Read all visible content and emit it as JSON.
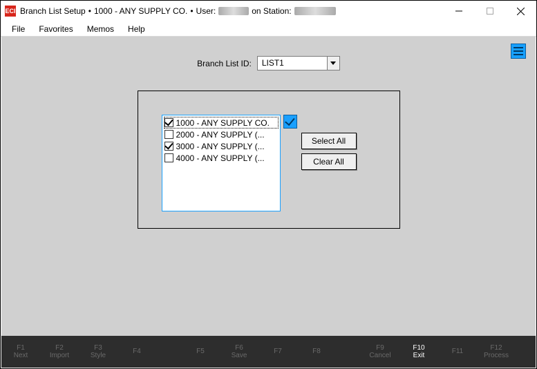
{
  "title": {
    "app_icon_text": "ECI",
    "window_name": "Branch List Setup",
    "sep": "•",
    "company": "1000 - ANY SUPPLY CO.",
    "user_prefix": "User:",
    "station_prefix": "on Station:"
  },
  "menu": {
    "file": "File",
    "favorites": "Favorites",
    "memos": "Memos",
    "help": "Help"
  },
  "form": {
    "id_label": "Branch List ID:",
    "id_value": "LIST1"
  },
  "branches": [
    {
      "label": "1000 - ANY SUPPLY CO.",
      "checked": true,
      "focused": true
    },
    {
      "label": "2000 - ANY SUPPLY (...",
      "checked": false,
      "focused": false
    },
    {
      "label": "3000 - ANY SUPPLY (...",
      "checked": true,
      "focused": false
    },
    {
      "label": "4000 - ANY SUPPLY (...",
      "checked": false,
      "focused": false
    }
  ],
  "buttons": {
    "select_all": "Select All",
    "clear_all": "Clear All"
  },
  "fkeys": [
    {
      "key": "F1",
      "label": "Next",
      "active": false
    },
    {
      "key": "F2",
      "label": "Import",
      "active": false
    },
    {
      "key": "F3",
      "label": "Style",
      "active": false
    },
    {
      "key": "F4",
      "label": "",
      "active": false
    },
    {
      "key": "F5",
      "label": "",
      "active": false
    },
    {
      "key": "F6",
      "label": "Save",
      "active": false
    },
    {
      "key": "F7",
      "label": "",
      "active": false
    },
    {
      "key": "F8",
      "label": "",
      "active": false
    },
    {
      "key": "F9",
      "label": "Cancel",
      "active": false
    },
    {
      "key": "F10",
      "label": "Exit",
      "active": true
    },
    {
      "key": "F11",
      "label": "",
      "active": false
    },
    {
      "key": "F12",
      "label": "Process",
      "active": false
    }
  ]
}
